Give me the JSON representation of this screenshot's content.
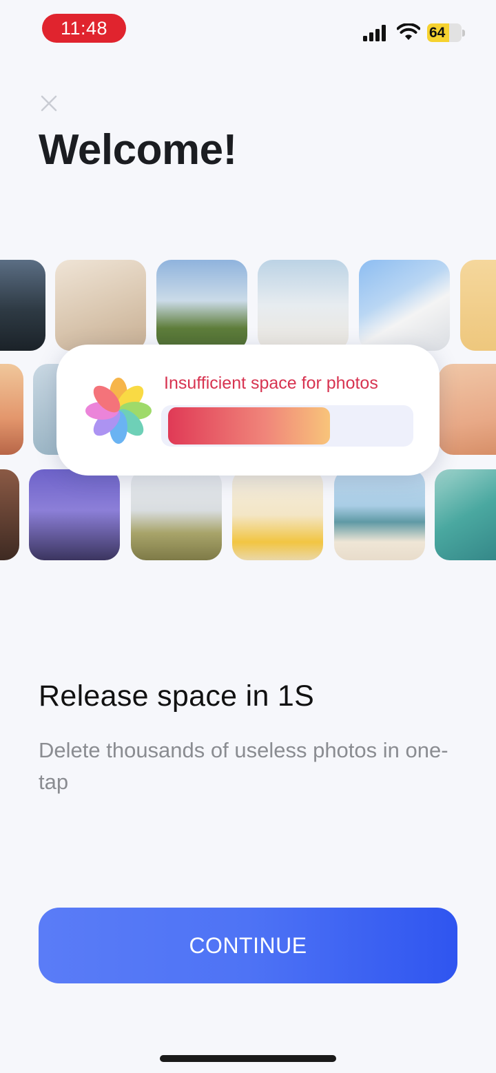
{
  "status_bar": {
    "time": "11:48",
    "battery_level": "64",
    "battery_fraction": 0.64,
    "icons": [
      "signal-icon",
      "wifi-icon",
      "battery-icon"
    ]
  },
  "header": {
    "close_icon": "close-icon",
    "title": "Welcome!"
  },
  "popup": {
    "icon": "photos-app-icon",
    "message": "Insufficient space for photos",
    "progress_fraction": 0.68
  },
  "content": {
    "heading": "Release space in 1S",
    "description": "Delete thousands of useless photos in one-tap"
  },
  "actions": {
    "continue_label": "CONTINUE"
  },
  "colors": {
    "accent_blue": "#4e73f5",
    "alert_red": "#d73350",
    "time_pill_red": "#e0242e",
    "background": "#f6f7fb"
  }
}
